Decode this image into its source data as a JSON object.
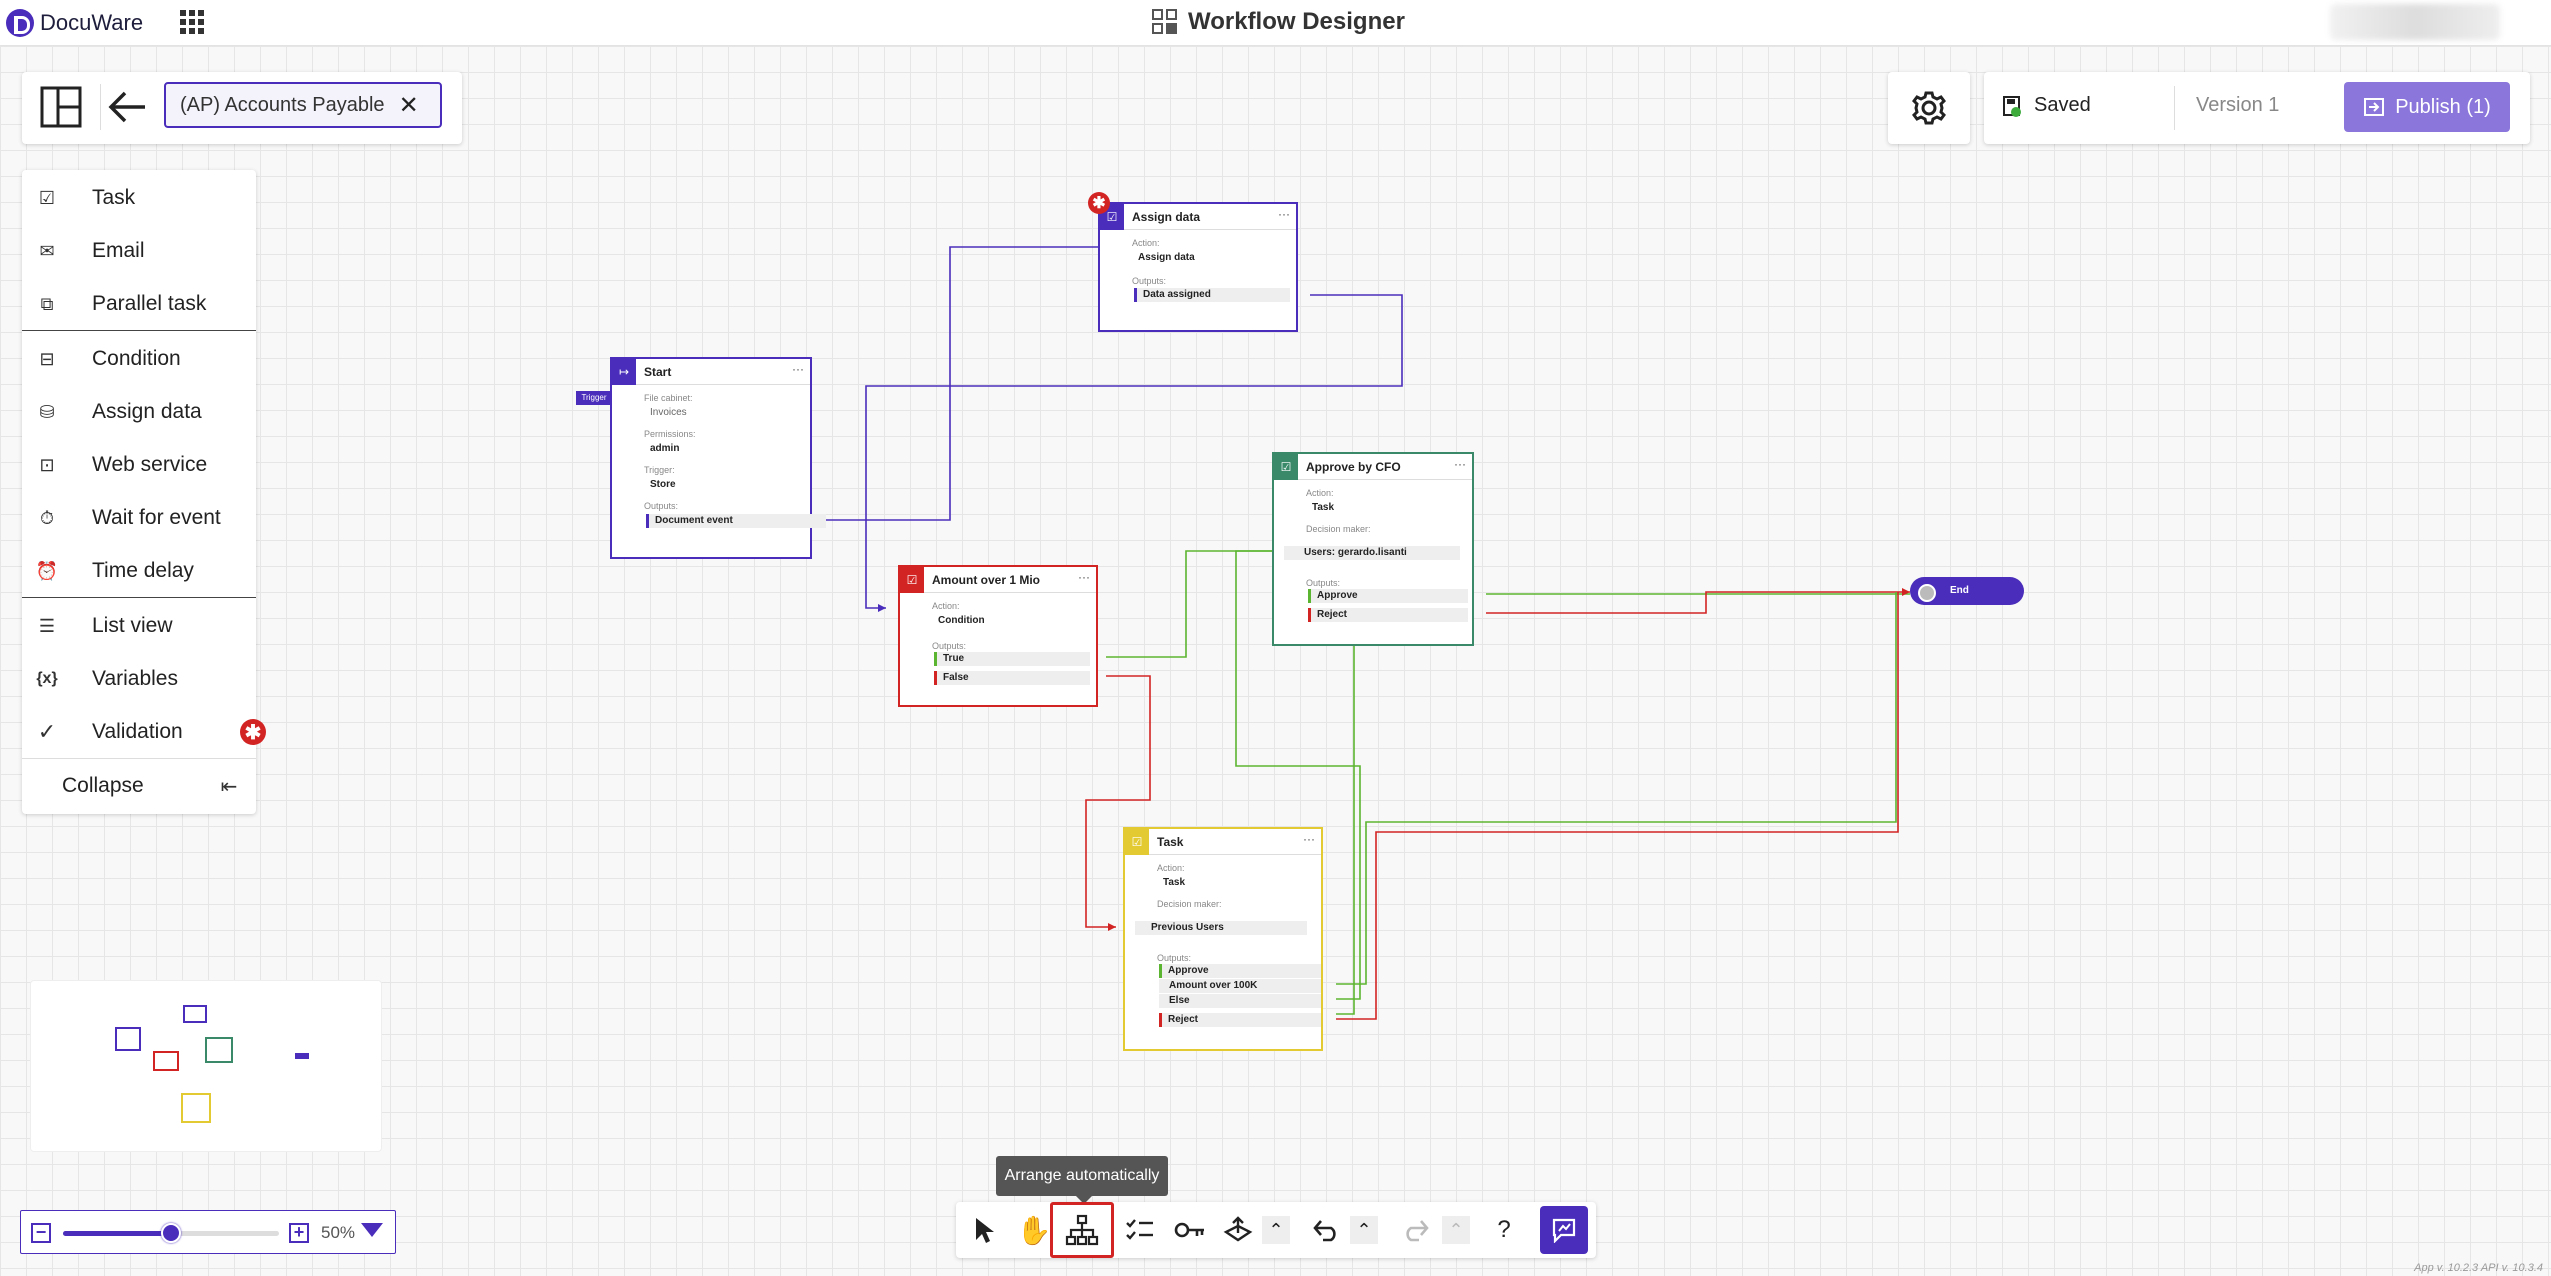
{
  "app": {
    "brand": "DocuWare",
    "title": "Workflow Designer"
  },
  "workflow": {
    "name": "(AP) Accounts Payable"
  },
  "status": {
    "saved": "Saved",
    "version": "Version 1",
    "publish": "Publish (1)"
  },
  "menu": {
    "items": [
      {
        "label": "Task",
        "icon": "task-icon"
      },
      {
        "label": "Email",
        "icon": "email-icon"
      },
      {
        "label": "Parallel task",
        "icon": "parallel-task-icon"
      },
      {
        "label": "Condition",
        "icon": "condition-icon"
      },
      {
        "label": "Assign data",
        "icon": "database-icon"
      },
      {
        "label": "Web service",
        "icon": "web-service-icon"
      },
      {
        "label": "Wait for event",
        "icon": "timer-icon"
      },
      {
        "label": "Time delay",
        "icon": "alarm-icon"
      },
      {
        "label": "List view",
        "icon": "list-icon"
      },
      {
        "label": "Variables",
        "icon": "variables-icon"
      },
      {
        "label": "Validation",
        "icon": "check-icon"
      }
    ],
    "collapse": "Collapse"
  },
  "zoom": {
    "value": "50%",
    "level": 0.5
  },
  "toolbar": {
    "tooltip": "Arrange automatically",
    "help": "?"
  },
  "nodes": {
    "start": {
      "title": "Start",
      "trigger": "Trigger",
      "l1": "File cabinet:",
      "v1": "Invoices",
      "l2": "Permissions:",
      "v2": "admin",
      "l3": "Trigger:",
      "v3": "Store",
      "l4": "Outputs:",
      "o1": "Document event"
    },
    "assign": {
      "title": "Assign data",
      "l1": "Action:",
      "v1": "Assign data",
      "l2": "Outputs:",
      "o1": "Data assigned"
    },
    "amount": {
      "title": "Amount over 1 Mio",
      "l1": "Action:",
      "v1": "Condition",
      "l2": "Outputs:",
      "o1": "True",
      "o2": "False"
    },
    "cfo": {
      "title": "Approve by CFO",
      "l1": "Action:",
      "v1": "Task",
      "l2": "Decision maker:",
      "v2": "Users: gerardo.lisanti",
      "l3": "Outputs:",
      "o1": "Approve",
      "o2": "Reject"
    },
    "task": {
      "title": "Task",
      "l1": "Action:",
      "v1": "Task",
      "l2": "Decision maker:",
      "v2": "Previous Users",
      "l3": "Outputs:",
      "o1": "Approve",
      "o2": "Amount over 100K",
      "o3": "Else",
      "o4": "Reject"
    },
    "end": {
      "title": "End"
    }
  },
  "colors": {
    "primary": "#4a2dbb",
    "green": "#5cb531",
    "red": "#d32424",
    "yellow": "#e3c932",
    "teal": "#3a8a6a"
  },
  "footer": {
    "version": "App v. 10.2.3 API v. 10.3.4"
  }
}
